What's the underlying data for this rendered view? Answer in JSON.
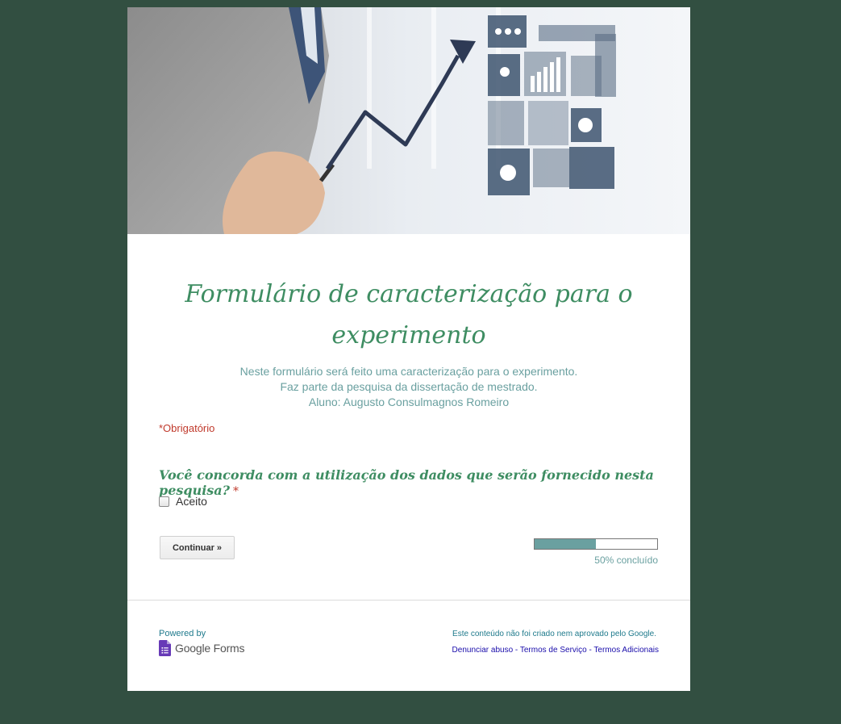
{
  "form": {
    "title": "Formulário de caracterização para o experimento",
    "description_lines": [
      "Neste formulário será feito uma caracterização para o experimento.",
      "Faz parte da pesquisa da dissertação de mestrado.",
      "Aluno: Augusto Consulmagnos Romeiro"
    ],
    "required_note": "*Obrigatório"
  },
  "question": {
    "text": "Você concorda com a utilização dos dados que serão fornecido nesta pesquisa?",
    "required_marker": "*",
    "options": [
      {
        "label": "Aceito",
        "checked": false
      }
    ]
  },
  "navigation": {
    "continue_label": "Continuar »"
  },
  "progress": {
    "fraction": 0.5,
    "label": "50% concluído"
  },
  "footer": {
    "powered_by": "Powered by",
    "brand": "Google Forms",
    "disclaimer": "Este conteúdo não foi criado nem aprovado pelo Google.",
    "links": {
      "report_abuse": "Denunciar abuso",
      "terms": "Termos de Serviço",
      "additional_terms": "Termos Adicionais",
      "separator": " - "
    }
  },
  "colors": {
    "page_background": "#324f41",
    "title_green": "#3e8d62",
    "description_teal": "#6aa0a0",
    "required_red": "#c0392b",
    "link_blue": "#1a0dab",
    "forms_purple": "#673ab7"
  },
  "icons": {
    "banner": "business-chart-banner-image",
    "forms_logo": "google-forms-icon"
  }
}
